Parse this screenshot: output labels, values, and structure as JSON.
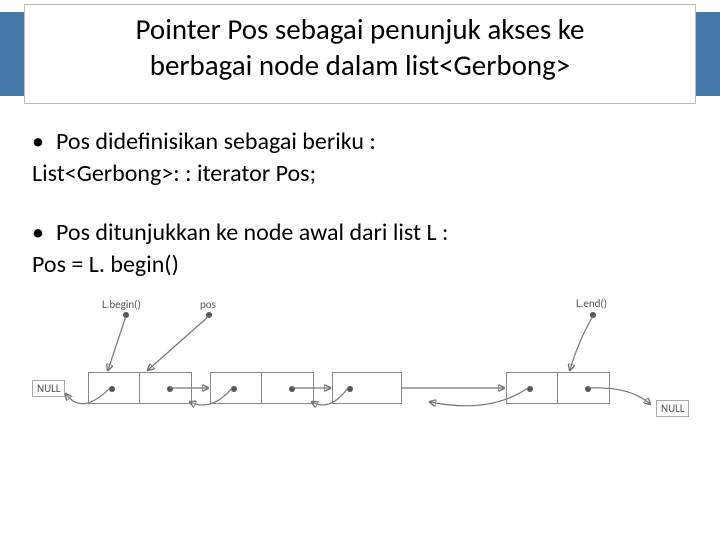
{
  "title": {
    "line1": "Pointer Pos sebagai penunjuk akses ke",
    "line2": "berbagai node dalam list<Gerbong>"
  },
  "body": {
    "bullet1": "Pos didefinisikan sebagai beriku :",
    "line1": "List<Gerbong>: : iterator Pos;",
    "bullet2": "Pos ditunjukkan ke node awal dari list L :",
    "line2": "Pos = L. begin()"
  },
  "diagram": {
    "lbegin": "L.begin()",
    "pos": "pos",
    "lend": "L.end()",
    "null": "NULL"
  }
}
